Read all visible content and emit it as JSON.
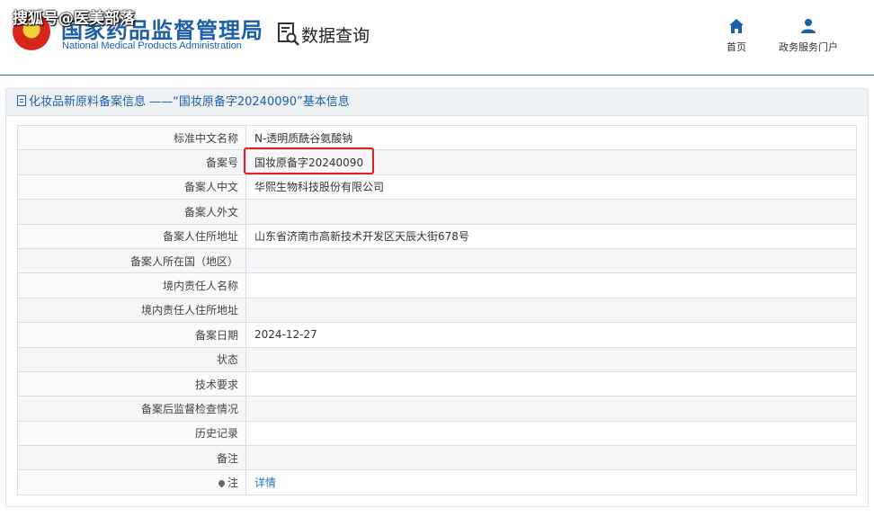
{
  "header": {
    "org_name_cn": "国家药品监督管理局",
    "org_name_en": "National Medical Products Administration",
    "watermark": "搜狐号@医美部落",
    "db_title": "数据查询",
    "nav": [
      {
        "label": "首页",
        "icon": "home-icon"
      },
      {
        "label": "政务服务门户",
        "icon": "user-icon"
      }
    ]
  },
  "panel": {
    "title": "化妆品新原料备案信息 ——“国妆原备字20240090”基本信息"
  },
  "rows": [
    {
      "label": "标准中文名称",
      "value": "N-透明质酰谷氨酸钠"
    },
    {
      "label": "备案号",
      "value": "国妆原备字20240090"
    },
    {
      "label": "备案人中文",
      "value": "华熙生物科技股份有限公司"
    },
    {
      "label": "备案人外文",
      "value": ""
    },
    {
      "label": "备案人住所地址",
      "value": "山东省济南市高新技术开发区天辰大街678号"
    },
    {
      "label": "备案人所在国（地区）",
      "value": ""
    },
    {
      "label": "境内责任人名称",
      "value": ""
    },
    {
      "label": "境内责任人住所地址",
      "value": ""
    },
    {
      "label": "备案日期",
      "value": "2024-12-27"
    },
    {
      "label": "状态",
      "value": ""
    },
    {
      "label": "技术要求",
      "value": ""
    },
    {
      "label": "备案后监督检查情况",
      "value": ""
    },
    {
      "label": "历史记录",
      "value": ""
    },
    {
      "label": "备注",
      "value": ""
    },
    {
      "label": "注",
      "value": "详情"
    }
  ],
  "colors": {
    "brand": "#1d5fa8",
    "highlight": "#e02020"
  }
}
